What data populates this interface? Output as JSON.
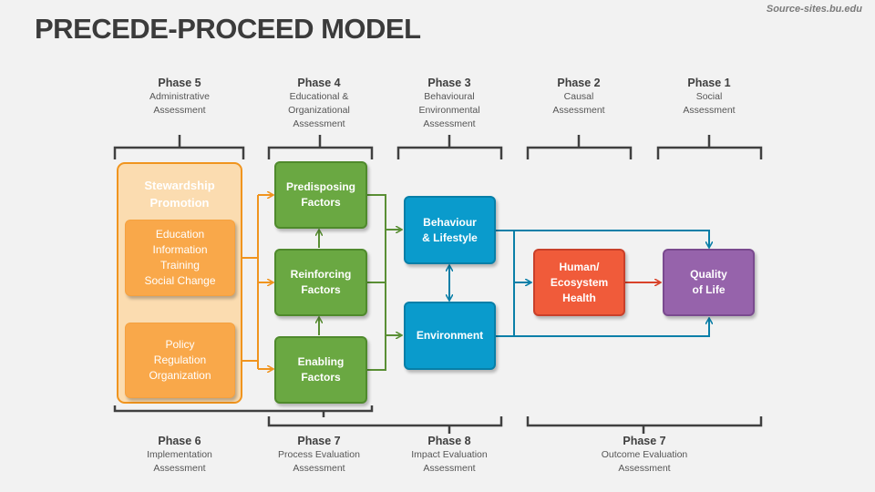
{
  "header": {
    "title": "PRECEDE-PROCEED MODEL",
    "source": "Source-sites.bu.edu"
  },
  "top_phases": [
    {
      "title": "Phase 5",
      "desc": "Administrative\nAssessment"
    },
    {
      "title": "Phase 4",
      "desc": "Educational &\nOrganizational\nAssessment"
    },
    {
      "title": "Phase 3",
      "desc": "Behavioural\nEnvironmental\nAssessment"
    },
    {
      "title": "Phase 2",
      "desc": "Causal\nAssessment"
    },
    {
      "title": "Phase 1",
      "desc": "Social\nAssessment"
    }
  ],
  "bottom_phases": [
    {
      "title": "Phase 6",
      "desc": "Implementation\nAssessment"
    },
    {
      "title": "Phase 7",
      "desc": "Process Evaluation\nAssessment"
    },
    {
      "title": "Phase 8",
      "desc": "Impact Evaluation\nAssessment"
    },
    {
      "title": "Phase 7",
      "desc": "Outcome Evaluation\nAssessment"
    }
  ],
  "boxes": {
    "stewardship": "Stewardship\nPromotion",
    "education": "Education\nInformation\nTraining\nSocial Change",
    "policy": "Policy\nRegulation\nOrganization",
    "predisposing": "Predisposing\nFactors",
    "reinforcing": "Reinforcing\nFactors",
    "enabling": "Enabling\nFactors",
    "behaviour": "Behaviour\n& Lifestyle",
    "environment": "Environment",
    "health": "Human/\nEcosystem\nHealth",
    "quality": "Quality\nof Life"
  },
  "colors": {
    "orange": "#f0941e",
    "green": "#5a8f35",
    "blue": "#0a7fa8",
    "red": "#d9432a",
    "bracket": "#404040"
  }
}
